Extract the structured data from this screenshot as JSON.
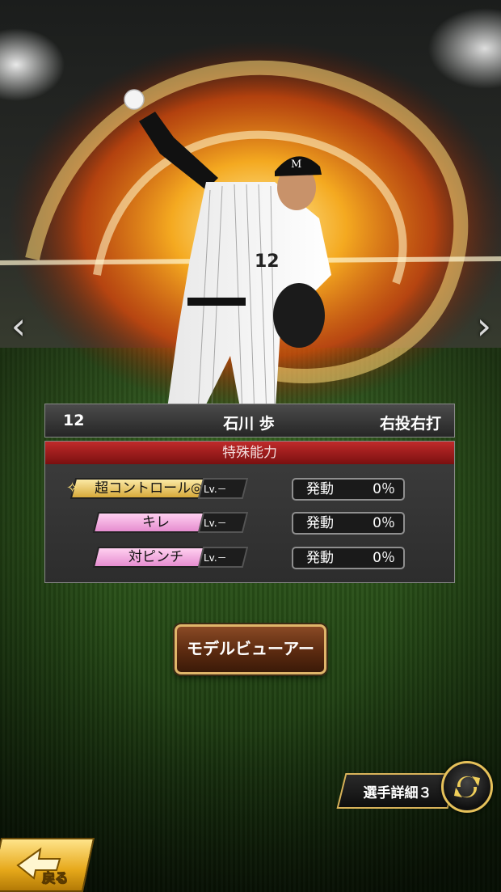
{
  "player": {
    "number": "12",
    "name": "石川 歩",
    "throw_bat": "右投右打"
  },
  "abilities": {
    "header": "特殊能力",
    "items": [
      {
        "label": "超コントロール◎",
        "prefix_icon": "sparkle-icon",
        "tier": "gold",
        "level": "Lv.－",
        "status": "発動",
        "rate": "0％"
      },
      {
        "label": "キレ",
        "tier": "pink",
        "level": "Lv.－",
        "status": "発動",
        "rate": "0％"
      },
      {
        "label": "対ピンチ",
        "tier": "pink",
        "level": "Lv.－",
        "status": "発動",
        "rate": "0％"
      }
    ]
  },
  "buttons": {
    "model_viewer": "モデルビューアー",
    "player_detail": "選手詳細３",
    "back": "戻る",
    "prev_icon": "chevron-left-icon",
    "next_icon": "chevron-right-icon",
    "swap_icon": "swap-arrows-icon"
  },
  "colors": {
    "ability_header": "#a51c1c",
    "gold_tag": "#e9c566",
    "pink_tag": "#f0a6dd",
    "button_brown": "#6b3416",
    "accent_gold": "#e6c15a"
  }
}
